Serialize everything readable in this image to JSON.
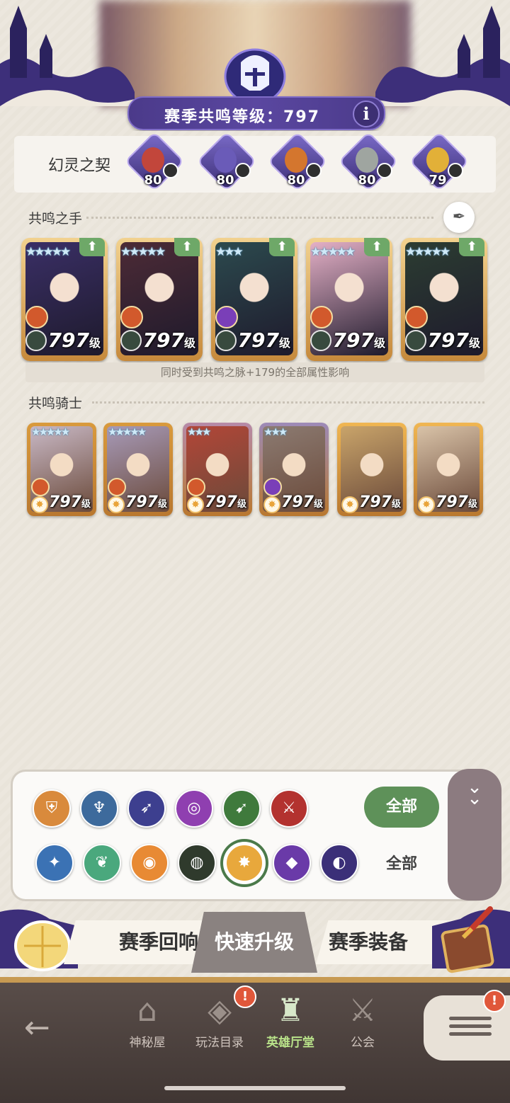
{
  "header": {
    "level_label": "赛季共鸣等级：797",
    "info_glyph": "i"
  },
  "contract": {
    "title": "幻灵之契",
    "pets": [
      {
        "level": "80",
        "color": "#c2463b"
      },
      {
        "level": "80",
        "color": "#6a5bb8"
      },
      {
        "level": "80",
        "color": "#d4762e"
      },
      {
        "level": "80",
        "color": "#9fa5a0"
      },
      {
        "level": "79",
        "color": "#e2b038"
      }
    ]
  },
  "resonance_hand": {
    "title": "共鸣之手",
    "caption": "同时受到共鸣之脉+179的全部属性影响",
    "level_suffix": "级",
    "cards": [
      {
        "level": "797",
        "stars": "★★★★★",
        "art": "#3a2f66",
        "faction": "#d2592c"
      },
      {
        "level": "797",
        "stars": "★★★★★",
        "art": "#4d2b36",
        "faction": "#d2592c"
      },
      {
        "level": "797",
        "stars": "★★★",
        "art": "#2c4a4e",
        "faction": "#7a3fb8"
      },
      {
        "level": "797",
        "stars": "★★★★★",
        "art": "#e4b0c6",
        "faction": "#d2592c"
      },
      {
        "level": "797",
        "stars": "★★★★★",
        "art": "#2c3d32",
        "faction": "#d2592c"
      }
    ]
  },
  "resonance_knights": {
    "title": "共鸣骑士",
    "level_suffix": "级",
    "cards": [
      {
        "level": "797",
        "stars": "★★★★★",
        "art": "#c9b9c6",
        "frame": "#d99a3d"
      },
      {
        "level": "797",
        "stars": "★★★★★",
        "art": "#a79ab8",
        "frame": "#d99a3d"
      },
      {
        "level": "797",
        "stars": "★★★",
        "art": "#b34638",
        "frame": "#b68aa8"
      },
      {
        "level": "797",
        "stars": "★★★",
        "art": "#8c7b72",
        "frame": "#9d8ab8"
      },
      {
        "level": "797",
        "stars": "",
        "art": "#c9a46a",
        "frame": "#f0b652"
      },
      {
        "level": "797",
        "stars": "",
        "art": "#d9c3a8",
        "frame": "#f0b652"
      }
    ]
  },
  "filter": {
    "all_button": "全部",
    "all_text": "全部",
    "row1": [
      {
        "icon": "shield-class-icon",
        "color": "#d98a3c"
      },
      {
        "icon": "mage-class-icon",
        "color": "#3d6a9c"
      },
      {
        "icon": "ranger-class-icon",
        "color": "#3d3f8f"
      },
      {
        "icon": "support-class-icon",
        "color": "#8f3fb0"
      },
      {
        "icon": "assassin-class-icon",
        "color": "#3f7a3c"
      },
      {
        "icon": "warrior-class-icon",
        "color": "#b3322f"
      }
    ],
    "row2": [
      {
        "icon": "celestial-faction-icon",
        "color": "#3b72b4"
      },
      {
        "icon": "forest-faction-icon",
        "color": "#4aa87d"
      },
      {
        "icon": "lightbearer-faction-icon",
        "color": "#e88a34"
      },
      {
        "icon": "mauler-faction-icon",
        "color": "#2f3a2c"
      },
      {
        "icon": "dimensional-faction-icon",
        "color": "#e8a83c"
      },
      {
        "icon": "graveborn-faction-icon",
        "color": "#6a3aa8"
      },
      {
        "icon": "hypogean-faction-icon",
        "color": "#3b2f78"
      }
    ]
  },
  "banners": {
    "left": "赛季回响",
    "middle": "快速升级",
    "right": "赛季装备"
  },
  "nav": {
    "items": [
      {
        "label": "神秘屋"
      },
      {
        "label": "玩法目录"
      },
      {
        "label": "英雄厅堂"
      },
      {
        "label": "公会"
      }
    ],
    "badge_gift": "!",
    "badge_menu": "!"
  }
}
